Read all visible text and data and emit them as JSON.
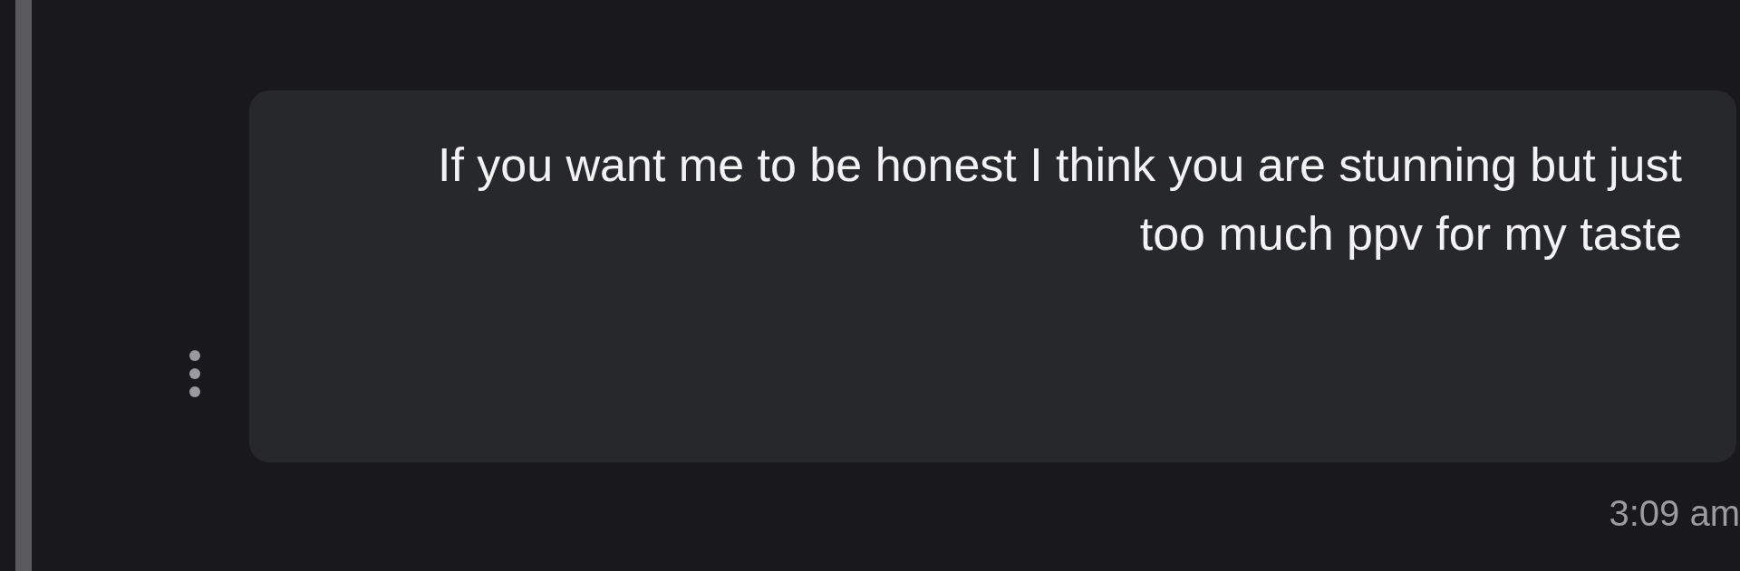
{
  "message": {
    "text": "If you want me to be honest I think you are stunning but just too much ppv for my taste",
    "time": "3:09 am"
  }
}
